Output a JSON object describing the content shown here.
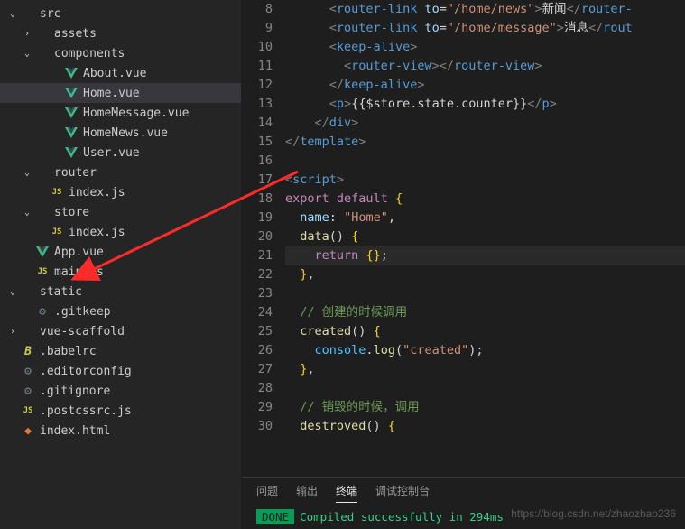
{
  "sidebar": {
    "items": [
      {
        "label": "src",
        "indent": "pad1",
        "chev": "⌄",
        "iconType": "none"
      },
      {
        "label": "assets",
        "indent": "pad2",
        "chev": "›",
        "iconType": "none"
      },
      {
        "label": "components",
        "indent": "pad2",
        "chev": "⌄",
        "iconType": "none"
      },
      {
        "label": "About.vue",
        "indent": "pad4",
        "chev": "",
        "iconType": "vue"
      },
      {
        "label": "Home.vue",
        "indent": "pad4",
        "chev": "",
        "iconType": "vue",
        "active": true
      },
      {
        "label": "HomeMessage.vue",
        "indent": "pad4",
        "chev": "",
        "iconType": "vue"
      },
      {
        "label": "HomeNews.vue",
        "indent": "pad4",
        "chev": "",
        "iconType": "vue"
      },
      {
        "label": "User.vue",
        "indent": "pad4",
        "chev": "",
        "iconType": "vue"
      },
      {
        "label": "router",
        "indent": "pad2",
        "chev": "⌄",
        "iconType": "none"
      },
      {
        "label": "index.js",
        "indent": "pad3",
        "chev": "",
        "iconType": "js"
      },
      {
        "label": "store",
        "indent": "pad2",
        "chev": "⌄",
        "iconType": "none"
      },
      {
        "label": "index.js",
        "indent": "pad3",
        "chev": "",
        "iconType": "js"
      },
      {
        "label": "App.vue",
        "indent": "pad2",
        "chev": "",
        "iconType": "vue"
      },
      {
        "label": "main.js",
        "indent": "pad2",
        "chev": "",
        "iconType": "js"
      },
      {
        "label": "static",
        "indent": "pad1",
        "chev": "⌄",
        "iconType": "none"
      },
      {
        "label": ".gitkeep",
        "indent": "pad2",
        "chev": "",
        "iconType": "gear"
      },
      {
        "label": "vue-scaffold",
        "indent": "pad1",
        "chev": "›",
        "iconType": "none"
      },
      {
        "label": ".babelrc",
        "indent": "pad1",
        "chev": "",
        "iconType": "b"
      },
      {
        "label": ".editorconfig",
        "indent": "pad1",
        "chev": "",
        "iconType": "gear"
      },
      {
        "label": ".gitignore",
        "indent": "pad1",
        "chev": "",
        "iconType": "gear"
      },
      {
        "label": ".postcssrc.js",
        "indent": "pad1",
        "chev": "",
        "iconType": "js"
      },
      {
        "label": "index.html",
        "indent": "pad1",
        "chev": "",
        "iconType": "html"
      }
    ]
  },
  "editor": {
    "lineNumbers": [
      8,
      9,
      10,
      11,
      12,
      13,
      14,
      15,
      16,
      17,
      18,
      19,
      20,
      21,
      22,
      23,
      24,
      25,
      26,
      27,
      28,
      29,
      30
    ],
    "code": {
      "l8a": "router-link",
      "l8_to": "to",
      "l8_val": "\"/home/news\"",
      "l8_text": "新闻",
      "l8b": "router-",
      "l9a": "router-link",
      "l9_to": "to",
      "l9_val": "\"/home/message\"",
      "l9_text": "消息",
      "l9b": "rout",
      "l10": "keep-alive",
      "l11": "router-view",
      "l12": "keep-alive",
      "l13_p": "p",
      "l13_expr": "{{$store.state.counter}}",
      "l14": "div",
      "l15": "template",
      "l17": "script",
      "l18_export": "export",
      "l18_default": "default",
      "l19_name": "name",
      "l19_val": "\"Home\"",
      "l20_data": "data",
      "l21_return": "return",
      "l24_comment": "// 创建的时候调用",
      "l25_created": "created",
      "l26_console": "console",
      "l26_log": "log",
      "l26_val": "\"created\"",
      "l29_comment": "// 销毁的时候，调用",
      "l30_destroyed": "destroved"
    }
  },
  "terminal": {
    "tabs": [
      "问题",
      "输出",
      "终端",
      "调试控制台"
    ],
    "activeTab": 2,
    "done": "DONE",
    "message": "Compiled successfully in 294ms"
  },
  "watermark": "https://blog.csdn.net/zhaozhao236"
}
